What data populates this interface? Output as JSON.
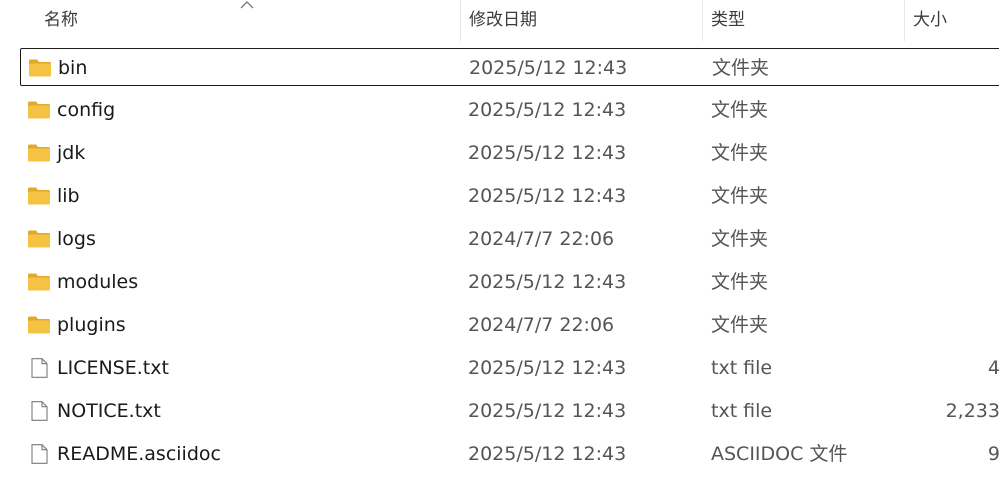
{
  "columns": {
    "name": "名称",
    "date": "修改日期",
    "type": "类型",
    "size": "大小"
  },
  "sort": {
    "column": "name",
    "direction": "ascending",
    "icon": "sort-up-arrow-icon"
  },
  "colors": {
    "folder": "#F5C244",
    "folder_tab": "#E0A92A",
    "file_outline": "#7a7a7a",
    "selection_border": "#1a1a1a"
  },
  "files": [
    {
      "name": "bin",
      "date": "2025/5/12 12:43",
      "type": "文件夹",
      "size": "",
      "kind": "folder",
      "selected": true
    },
    {
      "name": "config",
      "date": "2025/5/12 12:43",
      "type": "文件夹",
      "size": "",
      "kind": "folder"
    },
    {
      "name": "jdk",
      "date": "2025/5/12 12:43",
      "type": "文件夹",
      "size": "",
      "kind": "folder"
    },
    {
      "name": "lib",
      "date": "2025/5/12 12:43",
      "type": "文件夹",
      "size": "",
      "kind": "folder"
    },
    {
      "name": "logs",
      "date": "2024/7/7 22:06",
      "type": "文件夹",
      "size": "",
      "kind": "folder"
    },
    {
      "name": "modules",
      "date": "2025/5/12 12:43",
      "type": "文件夹",
      "size": "",
      "kind": "folder"
    },
    {
      "name": "plugins",
      "date": "2024/7/7 22:06",
      "type": "文件夹",
      "size": "",
      "kind": "folder"
    },
    {
      "name": "LICENSE.txt",
      "date": "2025/5/12 12:43",
      "type": "txt file",
      "size": "4",
      "kind": "file"
    },
    {
      "name": "NOTICE.txt",
      "date": "2025/5/12 12:43",
      "type": "txt file",
      "size": "2,233",
      "kind": "file"
    },
    {
      "name": "README.asciidoc",
      "date": "2025/5/12 12:43",
      "type": "ASCIIDOC 文件",
      "size": "9",
      "kind": "file"
    }
  ]
}
